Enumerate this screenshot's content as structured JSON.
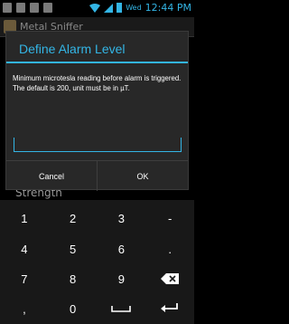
{
  "status_bar": {
    "day": "Wed",
    "time": "12:44 PM",
    "accent": "#33b5e5"
  },
  "background_app": {
    "title": "Metal Sniffer",
    "strength_label": "Strength"
  },
  "dialog": {
    "title": "Define Alarm Level",
    "line1": "Minimum microtesla reading before alarm is triggered.",
    "line2": "The default is 200, unit must be in µT.",
    "input_value": "",
    "cancel_label": "Cancel",
    "ok_label": "OK"
  },
  "keyboard": {
    "rows": [
      [
        "1",
        "2",
        "3",
        "-"
      ],
      [
        "4",
        "5",
        "6",
        "."
      ],
      [
        "7",
        "8",
        "9",
        "backspace-icon"
      ],
      [
        ",",
        "0",
        "space-icon",
        "enter-icon"
      ]
    ]
  }
}
